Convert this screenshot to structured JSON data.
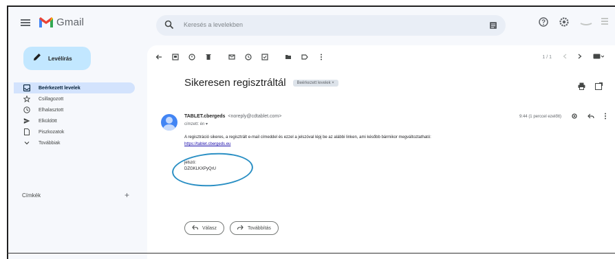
{
  "app": {
    "name": "Gmail"
  },
  "search": {
    "placeholder": "Keresés a levelekben"
  },
  "compose": {
    "label": "Levélírás"
  },
  "nav": [
    {
      "label": "Beérkezett levelek",
      "icon": "inbox-icon",
      "active": true
    },
    {
      "label": "Csillagozott",
      "icon": "star-icon",
      "active": false
    },
    {
      "label": "Elhalasztott",
      "icon": "clock-icon",
      "active": false
    },
    {
      "label": "Elküldött",
      "icon": "send-icon",
      "active": false
    },
    {
      "label": "Piszkozatok",
      "icon": "draft-icon",
      "active": false
    },
    {
      "label": "Továbbiak",
      "icon": "chevron-down-icon",
      "active": false
    }
  ],
  "contacts": {
    "label": "Címkék"
  },
  "message": {
    "subject": "Sikeresen regisztráltál",
    "label_chip": "Beérkezett levelek ×",
    "sender_name": "TABLET.cbergeds",
    "sender_email": "<noreply@cdtablet.com>",
    "recipient": "címzett: én ▾",
    "time": "9:44 (1 perccel ezelőtt)",
    "body": "A regisztráció sikeres, a regisztrált e-mail címeddel és ezzel a jelszóval lépj be az alábbi linken, ami később bármikor megváltoztatható:",
    "link": "https://tablet.cbergeds.eu",
    "password_label": "jelszó:",
    "password_value": "DZGKLKXPyQrU",
    "reply_label": "Válasz",
    "forward_label": "Továbbítás"
  },
  "toolbar": {
    "pager": "1 / 1"
  },
  "colors": {
    "accent": "#c2e7ff",
    "active_nav": "#d3e3fd",
    "annotation": "#2a8fc4"
  }
}
